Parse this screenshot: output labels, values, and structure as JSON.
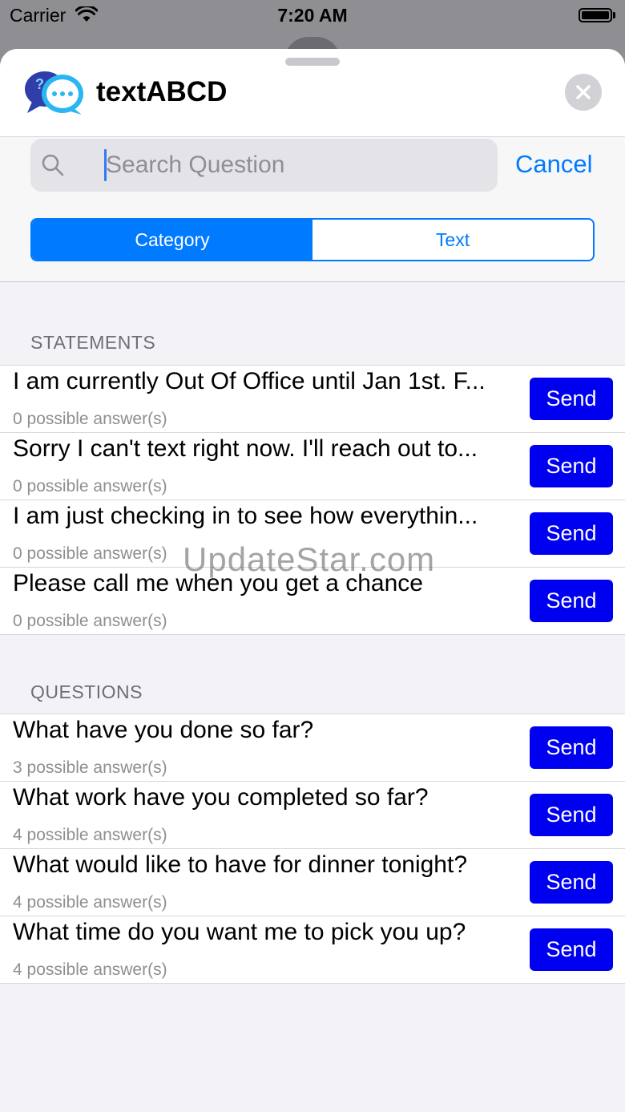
{
  "status_bar": {
    "carrier": "Carrier",
    "time": "7:20 AM"
  },
  "header": {
    "app_title": "textABCD"
  },
  "search": {
    "placeholder": "Search Question",
    "cancel_label": "Cancel"
  },
  "segmented": {
    "items": [
      "Category",
      "Text"
    ],
    "selected": "Category"
  },
  "sections": [
    {
      "header": "STATEMENTS",
      "rows": [
        {
          "title": "I am currently Out Of Office until Jan 1st. F...",
          "subtitle": "0 possible answer(s)",
          "button": "Send"
        },
        {
          "title": "Sorry I can't text right now. I'll reach out to...",
          "subtitle": "0 possible answer(s)",
          "button": "Send"
        },
        {
          "title": "I am just checking in to see how everythin...",
          "subtitle": "0 possible answer(s)",
          "button": "Send"
        },
        {
          "title": "Please call me when you get a chance",
          "subtitle": "0 possible answer(s)",
          "button": "Send"
        }
      ]
    },
    {
      "header": "QUESTIONS",
      "rows": [
        {
          "title": "What have you done so far?",
          "subtitle": "3 possible answer(s)",
          "button": "Send"
        },
        {
          "title": "What work have you completed so far?",
          "subtitle": "4 possible answer(s)",
          "button": "Send"
        },
        {
          "title": "What would like to have for dinner tonight?",
          "subtitle": "4 possible answer(s)",
          "button": "Send"
        },
        {
          "title": "What time do you want me to pick you up?",
          "subtitle": "4 possible answer(s)",
          "button": "Send"
        }
      ]
    }
  ],
  "watermark": "UpdateStar.com",
  "colors": {
    "accent": "#007aff",
    "send_button": "#0000f0"
  }
}
